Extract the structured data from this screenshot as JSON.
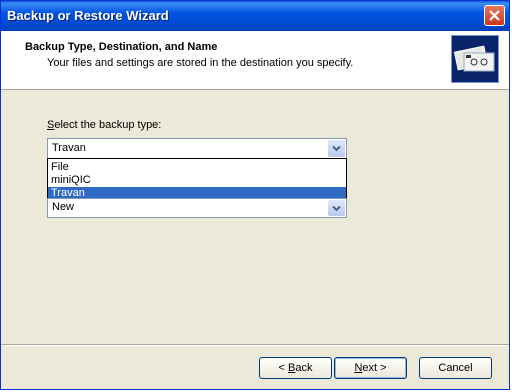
{
  "window": {
    "title": "Backup or Restore Wizard"
  },
  "header": {
    "title": "Backup Type, Destination, and Name",
    "subtitle": "Your files and settings are stored in the destination you specify."
  },
  "backup_type": {
    "label_accel": "S",
    "label_rest": "elect the backup type:",
    "selected": "Travan",
    "options": [
      "File",
      "miniQIC",
      "Travan"
    ]
  },
  "second_combo": {
    "value": "New"
  },
  "buttons": {
    "back_accel": "B",
    "back_rest": "ack",
    "next_accel": "N",
    "next_rest": "ext >",
    "cancel": "Cancel"
  }
}
